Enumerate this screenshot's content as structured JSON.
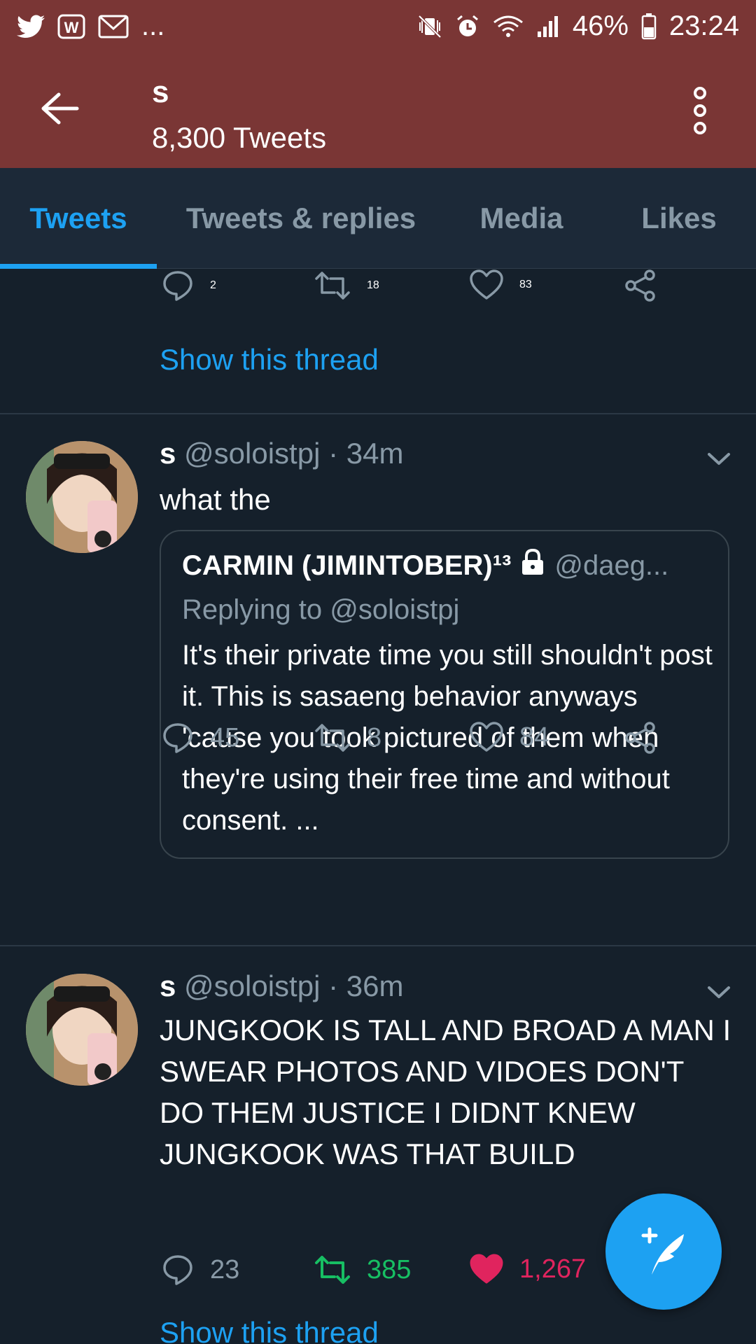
{
  "status_bar": {
    "icons_left": [
      "twitter-icon",
      "webtoon-icon",
      "gmail-icon"
    ],
    "more_indicator": "...",
    "icons_right": [
      "vibrate-icon",
      "alarm-icon",
      "wifi-icon",
      "signal-icon"
    ],
    "battery": "46%",
    "time": "23:24"
  },
  "header": {
    "title": "s",
    "subtitle": "8,300 Tweets"
  },
  "tabs": [
    {
      "label": "Tweets",
      "active": true
    },
    {
      "label": "Tweets & replies",
      "active": false
    },
    {
      "label": "Media",
      "active": false
    },
    {
      "label": "Likes",
      "active": false
    }
  ],
  "top_partial": {
    "replies": "2",
    "retweets": "18",
    "likes": "83",
    "show_thread": "Show this thread"
  },
  "tweets": [
    {
      "name": "s",
      "handle": "@soloistpj",
      "sep": "·",
      "time": "34m",
      "text": "what the",
      "quote": {
        "name": "CARMIN (JIMINTOBER)¹³",
        "handle": "@daeg...",
        "replying": "Replying to @soloistpj",
        "text": "It's their private time you still shouldn't post it. This is sasaeng behavior anyways 'cause you took pictured of them when they're using their free time and without consent. ..."
      },
      "replies": "45",
      "retweets": "8",
      "likes": "84"
    },
    {
      "name": "s",
      "handle": "@soloistpj",
      "sep": "·",
      "time": "36m",
      "text": "JUNGKOOK IS TALL AND BROAD A MAN I SWEAR PHOTOS AND VIDOES DON'T DO THEM JUSTICE I DIDNT KNEW JUNGKOOK WAS THAT BUILD",
      "replies": "23",
      "retweets": "385",
      "likes": "1,267",
      "retweeted": true,
      "liked": true,
      "show_thread": "Show this thread"
    }
  ],
  "colors": {
    "header_bg": "#7a3635",
    "page_bg": "#15202b",
    "accent": "#1da1f2",
    "retweet_green": "#17bf63",
    "like_red": "#e0245e",
    "muted": "#8899a6"
  }
}
